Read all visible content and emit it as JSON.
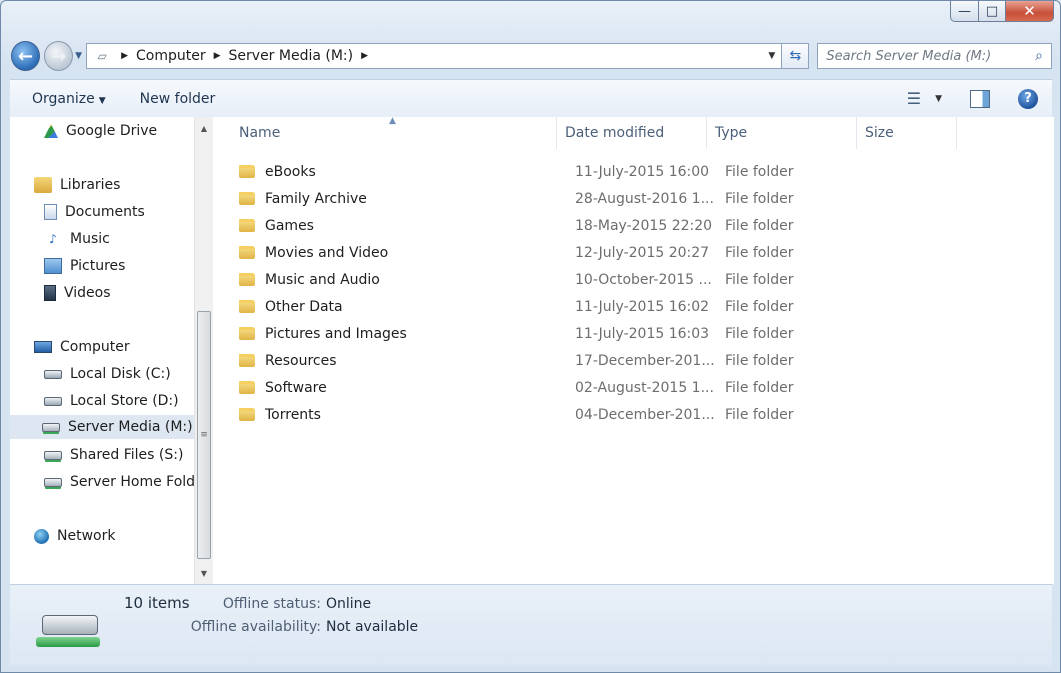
{
  "window": {
    "minimize_glyph": "—",
    "maximize_glyph": "□",
    "close_glyph": "✕"
  },
  "address_bar": {
    "crumbs": [
      "Computer",
      "Server Media (M:)"
    ],
    "icon": "network-drive-icon"
  },
  "search": {
    "placeholder": "Search Server Media (M:)"
  },
  "toolbar": {
    "organize_label": "Organize",
    "new_folder_label": "New folder"
  },
  "nav_pane": {
    "items": [
      {
        "label": "Google Drive",
        "icon": "google-drive-icon"
      },
      {
        "label": "Libraries",
        "icon": "libraries-icon"
      },
      {
        "label": "Documents",
        "icon": "documents-icon"
      },
      {
        "label": "Music",
        "icon": "music-icon"
      },
      {
        "label": "Pictures",
        "icon": "pictures-icon"
      },
      {
        "label": "Videos",
        "icon": "videos-icon"
      },
      {
        "label": "Computer",
        "icon": "computer-icon"
      },
      {
        "label": "Local Disk (C:)",
        "icon": "local-disk-icon"
      },
      {
        "label": "Local Store (D:)",
        "icon": "local-disk-icon"
      },
      {
        "label": "Server Media (M:)",
        "icon": "network-drive-icon"
      },
      {
        "label": "Shared Files (S:)",
        "icon": "network-drive-icon"
      },
      {
        "label": "Server Home Folde",
        "icon": "network-drive-icon"
      },
      {
        "label": "Network",
        "icon": "network-icon"
      }
    ],
    "selected_index": 9
  },
  "columns": {
    "name": "Name",
    "date": "Date modified",
    "type": "Type",
    "size": "Size"
  },
  "files": [
    {
      "name": "eBooks",
      "date": "11-July-2015 16:00",
      "type": "File folder"
    },
    {
      "name": "Family Archive",
      "date": "28-August-2016 1...",
      "type": "File folder"
    },
    {
      "name": "Games",
      "date": "18-May-2015 22:20",
      "type": "File folder"
    },
    {
      "name": "Movies and Video",
      "date": "12-July-2015 20:27",
      "type": "File folder"
    },
    {
      "name": "Music and Audio",
      "date": "10-October-2015 ...",
      "type": "File folder"
    },
    {
      "name": "Other Data",
      "date": "11-July-2015 16:02",
      "type": "File folder"
    },
    {
      "name": "Pictures and Images",
      "date": "11-July-2015 16:03",
      "type": "File folder"
    },
    {
      "name": "Resources",
      "date": "17-December-201...",
      "type": "File folder"
    },
    {
      "name": "Software",
      "date": "02-August-2015 1...",
      "type": "File folder"
    },
    {
      "name": "Torrents",
      "date": "04-December-201...",
      "type": "File folder"
    }
  ],
  "details": {
    "item_count": "10 items",
    "offline_status_label": "Offline status:",
    "offline_status_value": "Online",
    "offline_availability_label": "Offline availability:",
    "offline_availability_value": "Not available"
  }
}
